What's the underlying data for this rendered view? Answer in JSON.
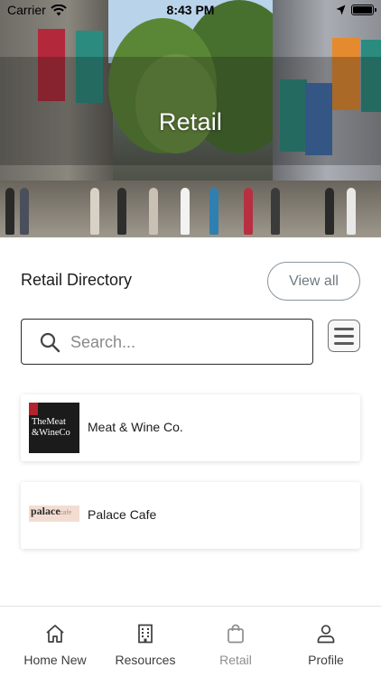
{
  "status_bar": {
    "carrier": "Carrier",
    "time": "8:43 PM"
  },
  "hero": {
    "title": "Retail"
  },
  "directory": {
    "title": "Retail Directory",
    "view_all_label": "View all",
    "search_placeholder": "Search...",
    "items": [
      {
        "name": "Meat & Wine Co.",
        "logo_text": [
          "TheMeat",
          "&WineCo"
        ]
      },
      {
        "name": "Palace Cafe",
        "logo_text": [
          "palace",
          "cafe"
        ]
      }
    ]
  },
  "tabs": [
    {
      "label": "Home New",
      "icon": "home-icon",
      "active": false
    },
    {
      "label": "Resources",
      "icon": "building-icon",
      "active": false
    },
    {
      "label": "Retail",
      "icon": "shopping-bag-icon",
      "active": true
    },
    {
      "label": "Profile",
      "icon": "person-icon",
      "active": false
    }
  ],
  "colors": {
    "accent": "#8a959c",
    "active_tab": "#8e8e8e",
    "inactive_tab": "#3d3d3d"
  }
}
